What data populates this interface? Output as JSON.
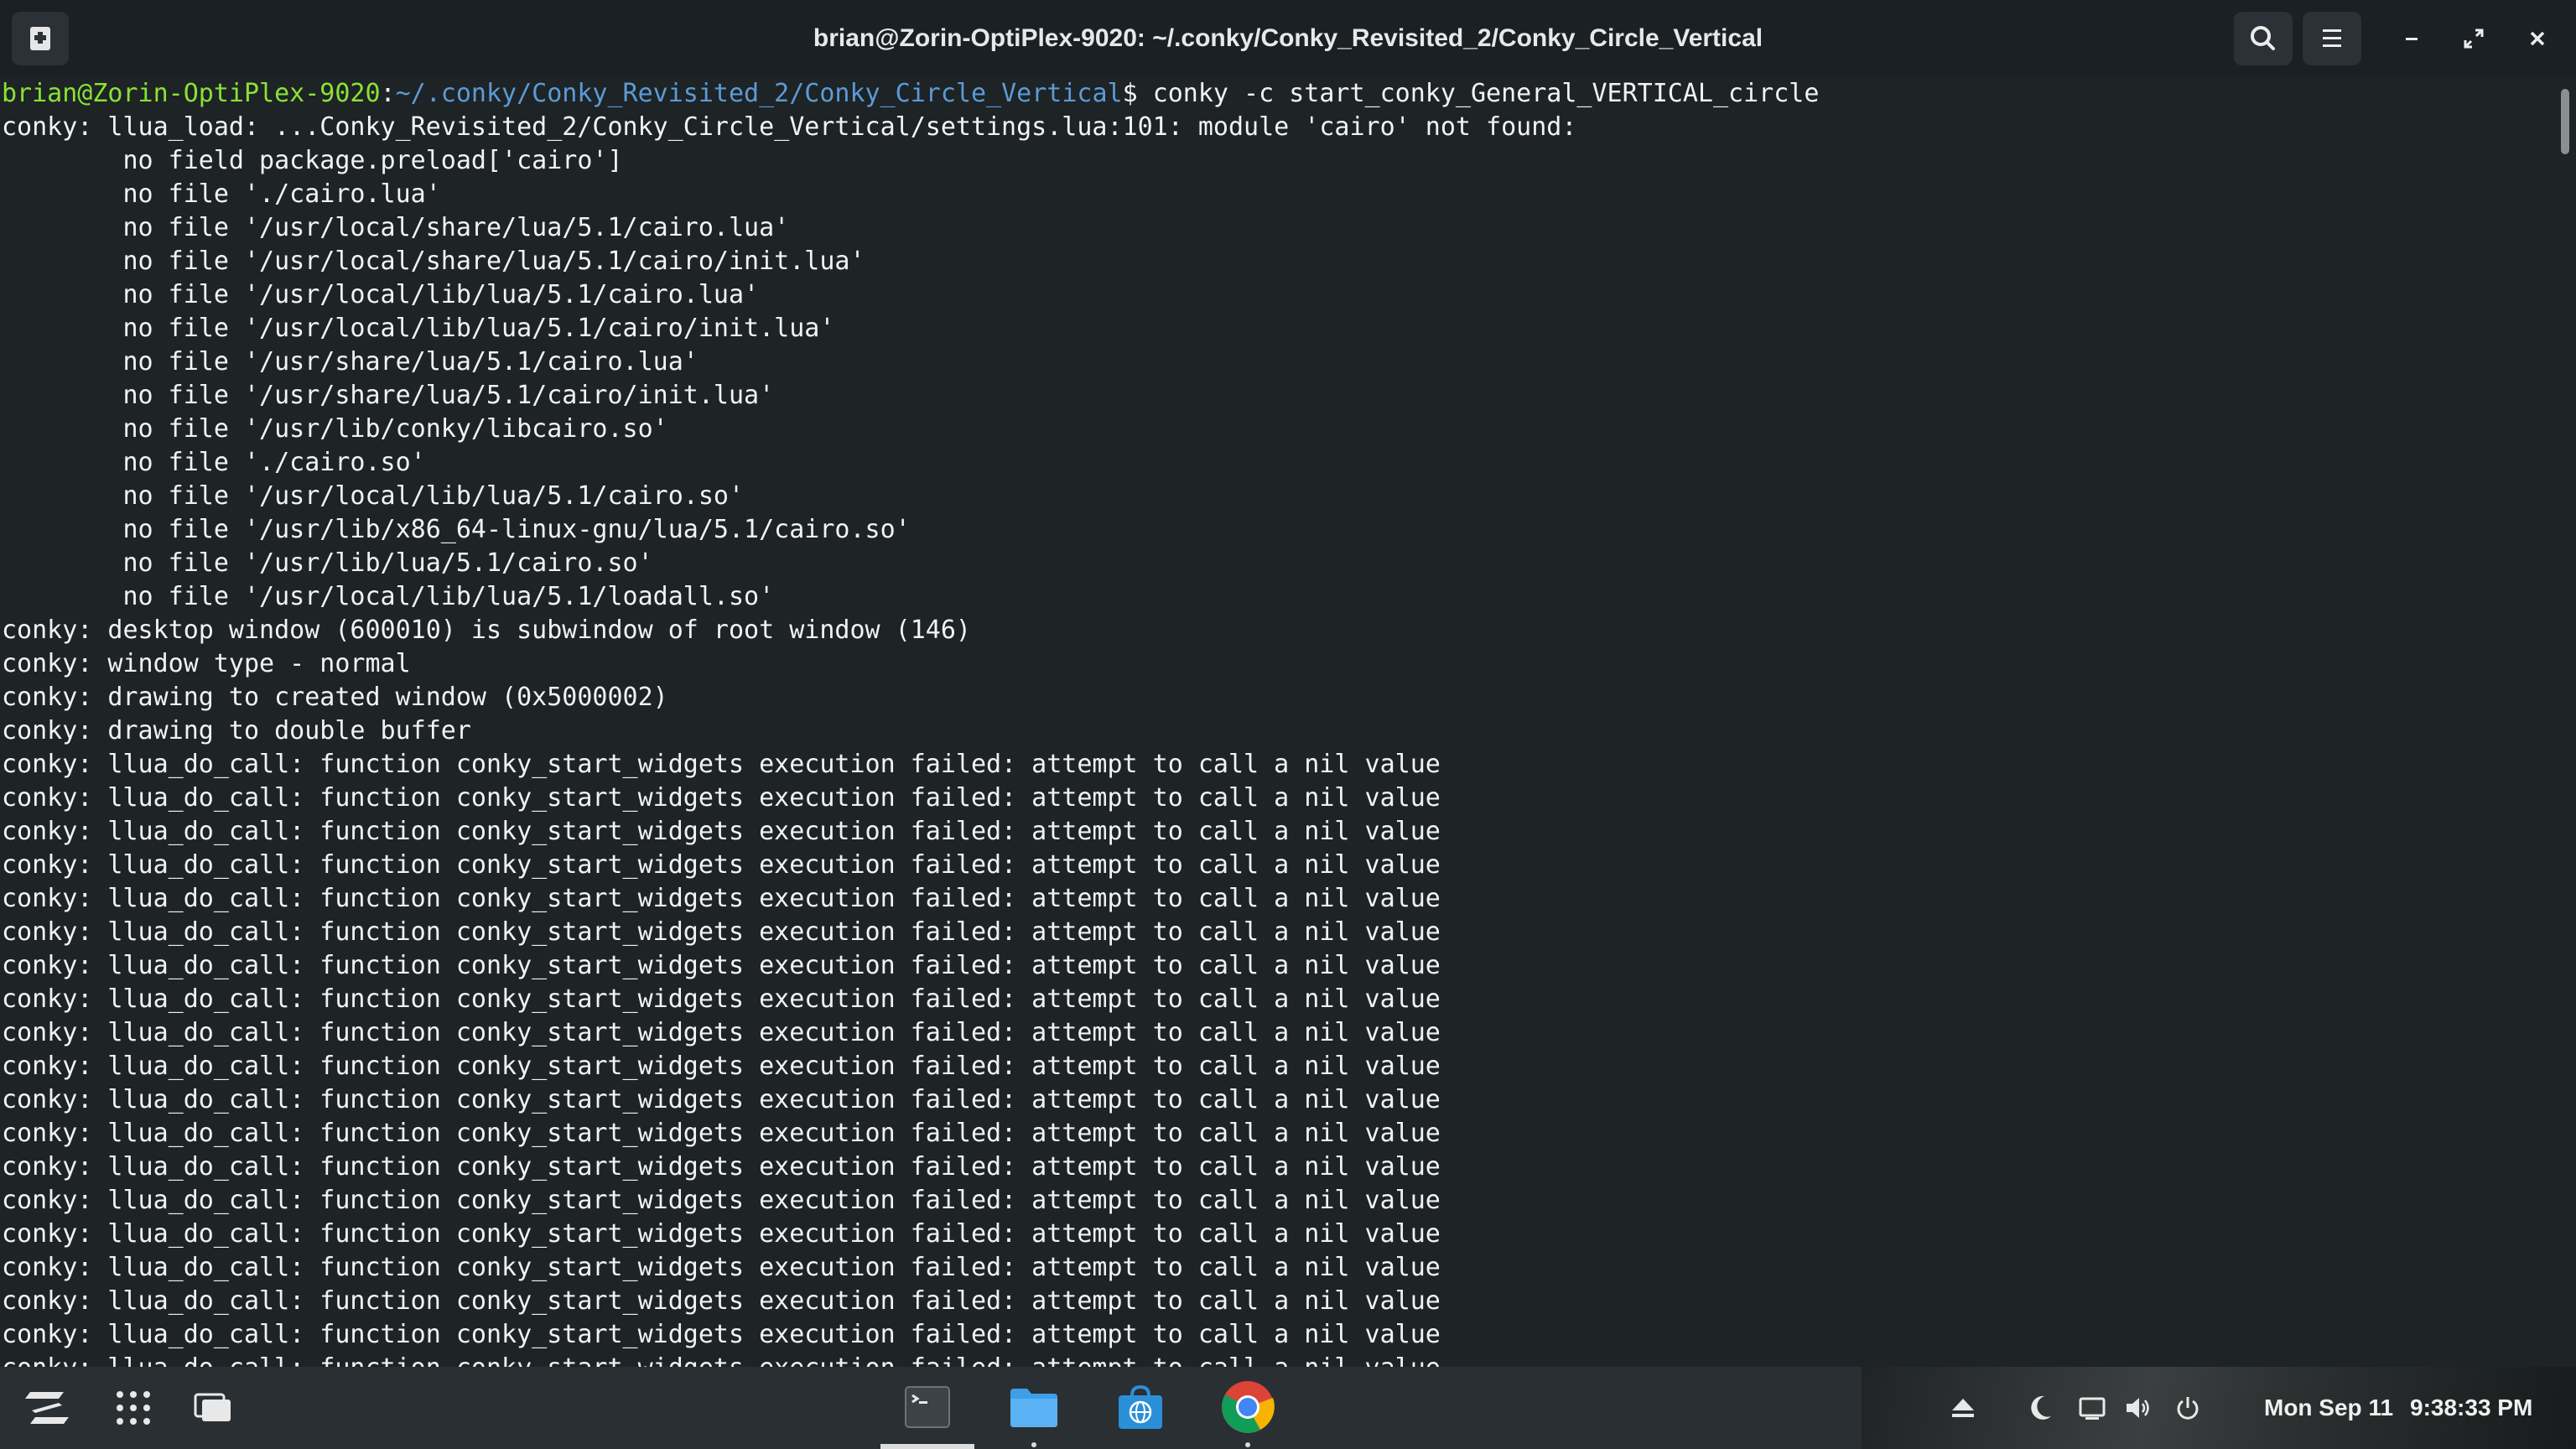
{
  "window": {
    "title": "brian@Zorin-OptiPlex-9020: ~/.conky/Conky_Revisited_2/Conky_Circle_Vertical",
    "icons": {
      "new_tab": "new-tab-icon",
      "search": "search-icon",
      "menu": "hamburger-menu-icon",
      "minimize": "minimize-icon",
      "restore": "restore-icon",
      "close": "close-icon"
    }
  },
  "terminal": {
    "prompt": {
      "user_host": "brian@Zorin-OptiPlex-9020",
      "separator": ":",
      "path": "~/.conky/Conky_Revisited_2/Conky_Circle_Vertical",
      "symbol": "$ ",
      "command": "conky -c start_conky_General_VERTICAL_circle"
    },
    "lines": [
      "conky: llua_load: ...Conky_Revisited_2/Conky_Circle_Vertical/settings.lua:101: module 'cairo' not found:",
      "        no field package.preload['cairo']",
      "        no file './cairo.lua'",
      "        no file '/usr/local/share/lua/5.1/cairo.lua'",
      "        no file '/usr/local/share/lua/5.1/cairo/init.lua'",
      "        no file '/usr/local/lib/lua/5.1/cairo.lua'",
      "        no file '/usr/local/lib/lua/5.1/cairo/init.lua'",
      "        no file '/usr/share/lua/5.1/cairo.lua'",
      "        no file '/usr/share/lua/5.1/cairo/init.lua'",
      "        no file '/usr/lib/conky/libcairo.so'",
      "        no file './cairo.so'",
      "        no file '/usr/local/lib/lua/5.1/cairo.so'",
      "        no file '/usr/lib/x86_64-linux-gnu/lua/5.1/cairo.so'",
      "        no file '/usr/lib/lua/5.1/cairo.so'",
      "        no file '/usr/local/lib/lua/5.1/loadall.so'",
      "conky: desktop window (600010) is subwindow of root window (146)",
      "conky: window type - normal",
      "conky: drawing to created window (0x5000002)",
      "conky: drawing to double buffer",
      "conky: llua_do_call: function conky_start_widgets execution failed: attempt to call a nil value",
      "conky: llua_do_call: function conky_start_widgets execution failed: attempt to call a nil value",
      "conky: llua_do_call: function conky_start_widgets execution failed: attempt to call a nil value",
      "conky: llua_do_call: function conky_start_widgets execution failed: attempt to call a nil value",
      "conky: llua_do_call: function conky_start_widgets execution failed: attempt to call a nil value",
      "conky: llua_do_call: function conky_start_widgets execution failed: attempt to call a nil value",
      "conky: llua_do_call: function conky_start_widgets execution failed: attempt to call a nil value",
      "conky: llua_do_call: function conky_start_widgets execution failed: attempt to call a nil value",
      "conky: llua_do_call: function conky_start_widgets execution failed: attempt to call a nil value",
      "conky: llua_do_call: function conky_start_widgets execution failed: attempt to call a nil value",
      "conky: llua_do_call: function conky_start_widgets execution failed: attempt to call a nil value",
      "conky: llua_do_call: function conky_start_widgets execution failed: attempt to call a nil value",
      "conky: llua_do_call: function conky_start_widgets execution failed: attempt to call a nil value",
      "conky: llua_do_call: function conky_start_widgets execution failed: attempt to call a nil value",
      "conky: llua_do_call: function conky_start_widgets execution failed: attempt to call a nil value",
      "conky: llua_do_call: function conky_start_widgets execution failed: attempt to call a nil value",
      "conky: llua_do_call: function conky_start_widgets execution failed: attempt to call a nil value",
      "conky: llua_do_call: function conky_start_widgets execution failed: attempt to call a nil value",
      "conky: llua_do_call: function conky_start_widgets execution failed: attempt to call a nil value"
    ],
    "colors": {
      "background": "#1e2326",
      "text": "#f2f2f2",
      "prompt_user": "#8ae234",
      "prompt_path": "#5b9bd5"
    }
  },
  "taskbar": {
    "left_icons": [
      "zorin-menu-icon",
      "app-grid-icon",
      "workspaces-icon"
    ],
    "apps": [
      "terminal-icon",
      "files-icon",
      "software-store-icon",
      "chrome-icon"
    ],
    "tray_icons": [
      "eject-icon",
      "night-light-moon-icon",
      "display-icon",
      "volume-icon",
      "power-icon"
    ],
    "clock": {
      "date": "Mon Sep 11",
      "time": "9:38:33 PM"
    }
  }
}
